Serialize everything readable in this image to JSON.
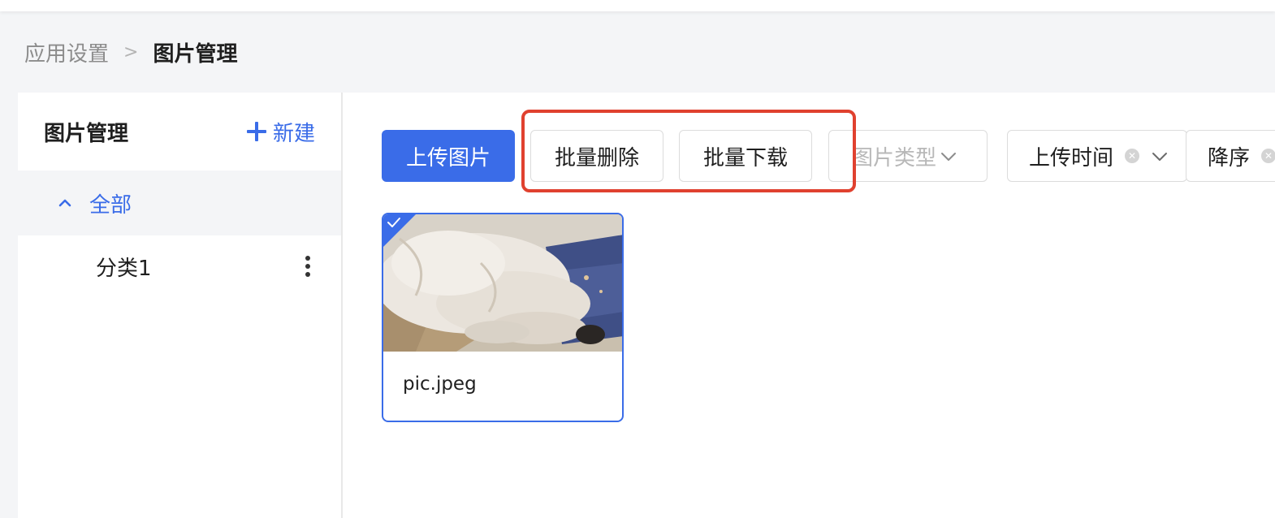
{
  "breadcrumb": {
    "parent": "应用设置",
    "separator": ">",
    "current": "图片管理"
  },
  "sidebar": {
    "title": "图片管理",
    "new_label": "新建",
    "tree": {
      "root_label": "全部",
      "items": [
        {
          "label": "分类1"
        }
      ]
    }
  },
  "toolbar": {
    "upload_label": "上传图片",
    "batch_delete_label": "批量删除",
    "batch_download_label": "批量下载",
    "type_placeholder": "图片类型",
    "time_value": "上传时间",
    "order_value": "降序"
  },
  "images": [
    {
      "name": "pic.jpeg",
      "selected": true
    }
  ],
  "colors": {
    "accent": "#3a6ce8",
    "highlight": "#e0412f"
  }
}
